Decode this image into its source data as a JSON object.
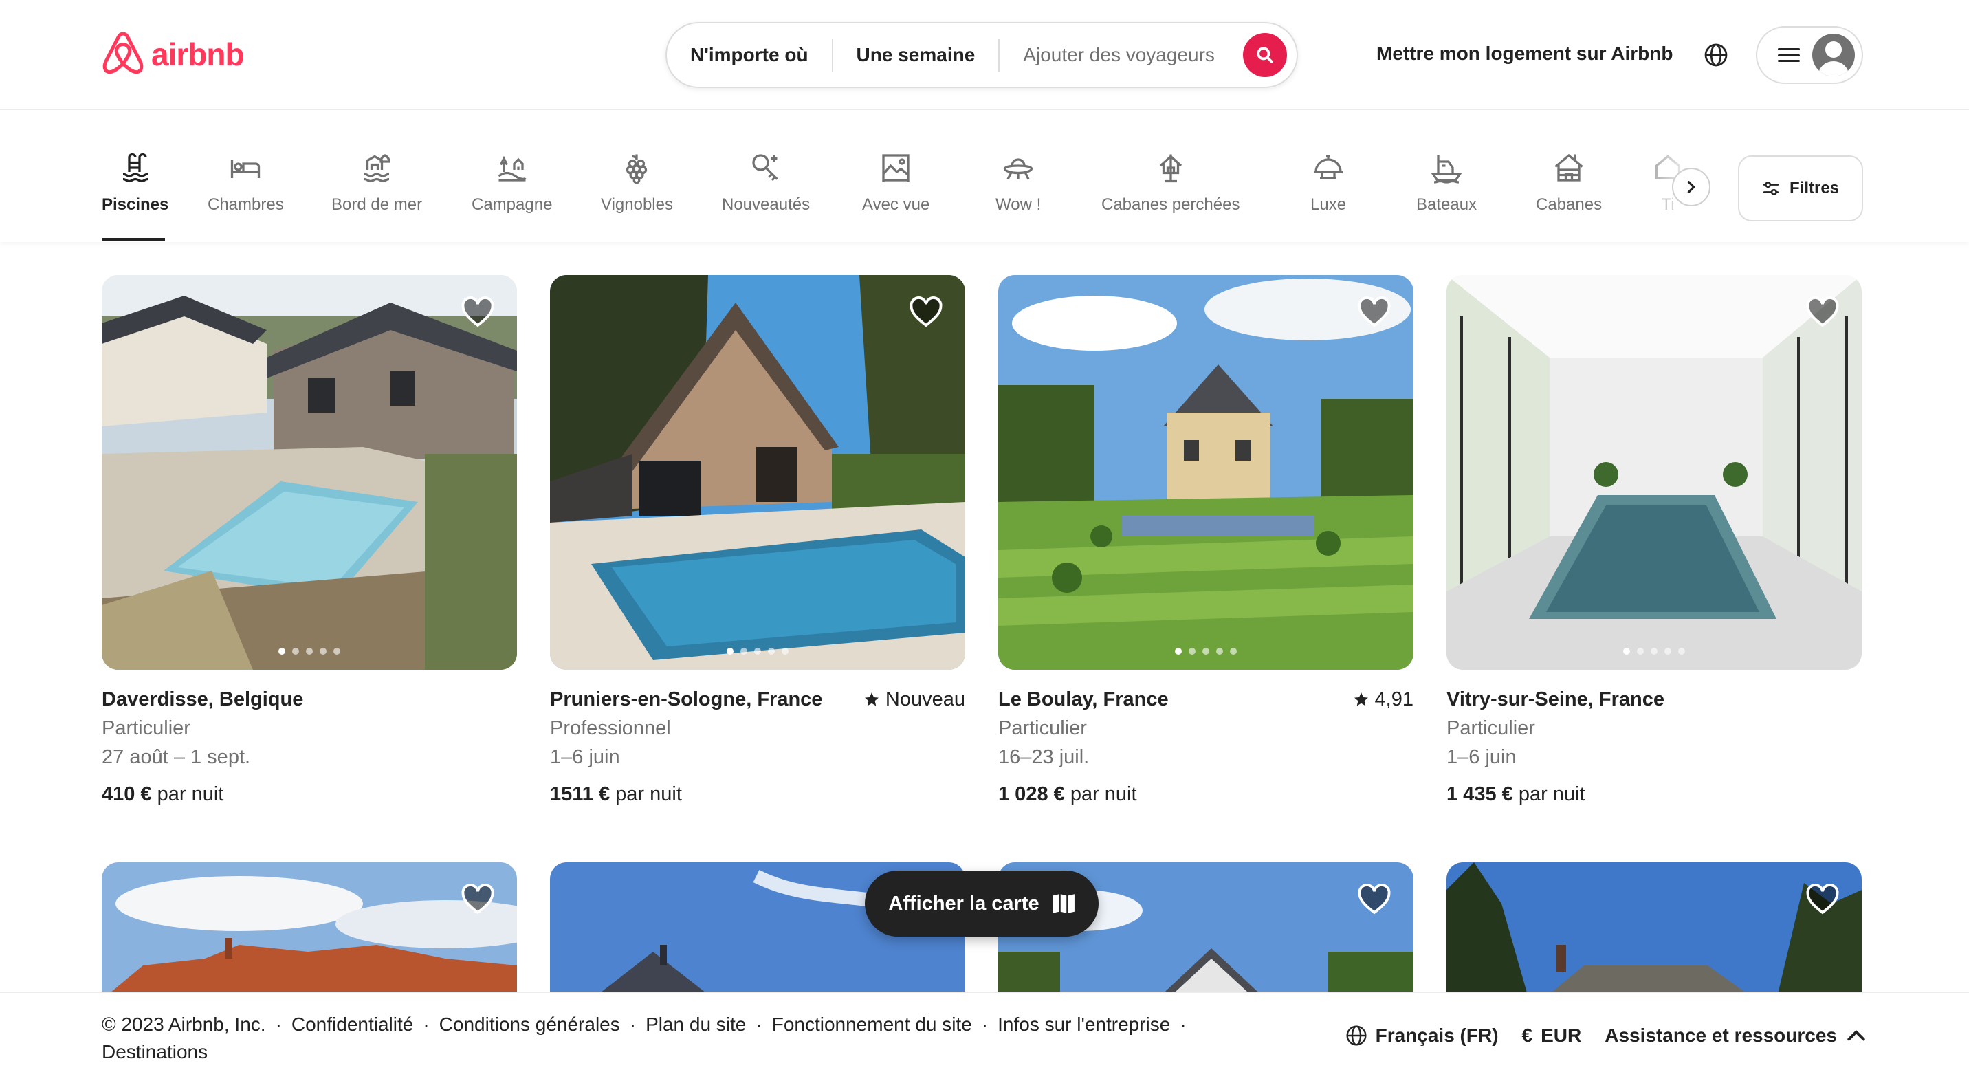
{
  "brand": {
    "name": "airbnb",
    "color": "#ff385c"
  },
  "search": {
    "where": "N'importe où",
    "when": "Une semaine",
    "guests": "Ajouter des voyageurs",
    "button_icon": "search-icon",
    "button_color": "#e61e4d"
  },
  "header": {
    "host_link": "Mettre mon logement sur Airbnb",
    "language_icon": "globe-icon",
    "menu_icon": "hamburger-icon",
    "avatar_icon": "user-avatar-icon"
  },
  "categories": {
    "items": [
      {
        "label": "Piscines",
        "icon": "pool-icon",
        "active": true
      },
      {
        "label": "Chambres",
        "icon": "bed-icon"
      },
      {
        "label": "Bord de mer",
        "icon": "beach-icon"
      },
      {
        "label": "Campagne",
        "icon": "countryside-icon"
      },
      {
        "label": "Vignobles",
        "icon": "grapes-icon"
      },
      {
        "label": "Nouveautés",
        "icon": "key-sparkle-icon"
      },
      {
        "label": "Avec vue",
        "icon": "view-icon"
      },
      {
        "label": "Wow !",
        "icon": "ufo-icon"
      },
      {
        "label": "Cabanes perchées",
        "icon": "treehouse-icon"
      },
      {
        "label": "Luxe",
        "icon": "luxe-icon"
      },
      {
        "label": "Bateaux",
        "icon": "boat-icon"
      },
      {
        "label": "Cabanes",
        "icon": "cabin-icon"
      },
      {
        "label": "Ti",
        "icon": "tiny-icon"
      }
    ],
    "next_icon": "chevron-right-icon",
    "filters_label": "Filtres",
    "filters_icon": "sliders-icon"
  },
  "listings": [
    {
      "location": "Daverdisse, Belgique",
      "host_type": "Particulier",
      "dates": "27 août – 1 sept.",
      "price": "410 €",
      "price_suffix": " par nuit",
      "rating": ""
    },
    {
      "location": "Pruniers-en-Sologne, France",
      "host_type": "Professionnel",
      "dates": "1–6 juin",
      "price": "1511 €",
      "price_suffix": " par nuit",
      "rating": "Nouveau"
    },
    {
      "location": "Le Boulay, France",
      "host_type": "Particulier",
      "dates": "16–23 juil.",
      "price": "1 028 €",
      "price_suffix": " par nuit",
      "rating": "4,91"
    },
    {
      "location": "Vitry-sur-Seine, France",
      "host_type": "Particulier",
      "dates": "1–6 juin",
      "price": "1 435 €",
      "price_suffix": " par nuit",
      "rating": ""
    }
  ],
  "map_button": {
    "label": "Afficher la carte",
    "icon": "map-icon"
  },
  "footer": {
    "copyright": "© 2023 Airbnb, Inc.",
    "links": [
      "Confidentialité",
      "Conditions générales",
      "Plan du site",
      "Fonctionnement du site",
      "Infos sur l'entreprise",
      "Destinations"
    ],
    "language": "Français (FR)",
    "currency_symbol": "€",
    "currency": "EUR",
    "support": "Assistance et ressources"
  }
}
